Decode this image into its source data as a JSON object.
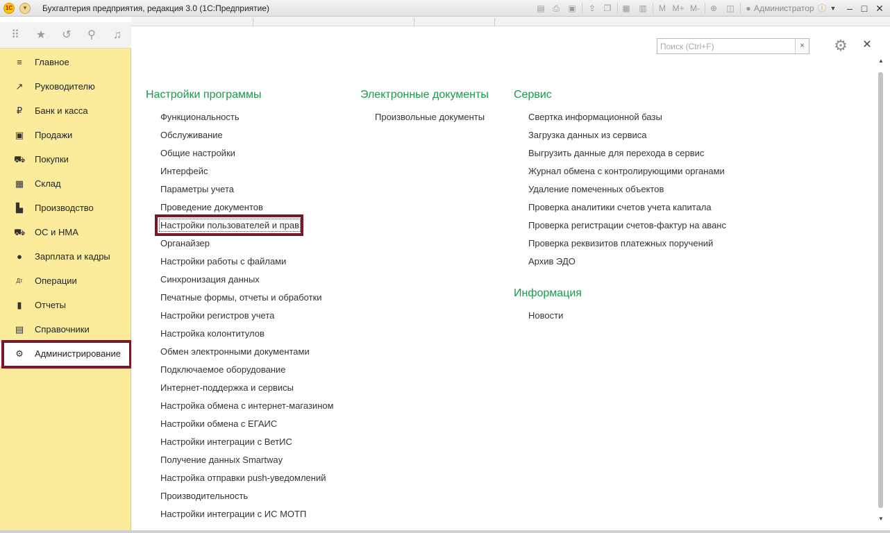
{
  "window": {
    "title": "Бухгалтерия предприятия, редакция 3.0  (1С:Предприятие)",
    "logo": "1С",
    "user": "Администратор",
    "toolbar_icons": [
      "save-icon",
      "print-icon",
      "preview-icon",
      "upload-icon",
      "copy-icon",
      "calculator-icon",
      "calendar-icon"
    ],
    "memory_buttons": [
      "M",
      "M+",
      "M-"
    ]
  },
  "sidebar": {
    "items": [
      {
        "label": "Главное",
        "icon": "menu-lines-icon",
        "glyph": "≡"
      },
      {
        "label": "Руководителю",
        "icon": "trend-icon",
        "glyph": "↗"
      },
      {
        "label": "Банк и касса",
        "icon": "ruble-icon",
        "glyph": "₽"
      },
      {
        "label": "Продажи",
        "icon": "bag-icon",
        "glyph": "▣"
      },
      {
        "label": "Покупки",
        "icon": "cart-icon",
        "glyph": "⛟"
      },
      {
        "label": "Склад",
        "icon": "warehouse-icon",
        "glyph": "▦"
      },
      {
        "label": "Производство",
        "icon": "factory-icon",
        "glyph": "▙"
      },
      {
        "label": "ОС и НМА",
        "icon": "truck-icon",
        "glyph": "⛟"
      },
      {
        "label": "Зарплата и кадры",
        "icon": "person-icon",
        "glyph": "●"
      },
      {
        "label": "Операции",
        "icon": "dt-kt-icon",
        "glyph": "Дт"
      },
      {
        "label": "Отчеты",
        "icon": "bar-chart-icon",
        "glyph": "▮"
      },
      {
        "label": "Справочники",
        "icon": "book-icon",
        "glyph": "▤"
      },
      {
        "label": "Администрирование",
        "icon": "gear-icon",
        "glyph": "⚙"
      }
    ]
  },
  "search": {
    "placeholder": "Поиск (Ctrl+F)",
    "clear": "×"
  },
  "sections": {
    "settings": {
      "title": "Настройки программы",
      "links": [
        "Функциональность",
        "Обслуживание",
        "Общие настройки",
        "Интерфейс",
        "Параметры учета",
        "Проведение документов",
        "Настройки пользователей и прав",
        "Органайзер",
        "Настройки работы с файлами",
        "Синхронизация данных",
        "Печатные формы, отчеты и обработки",
        "Настройки регистров учета",
        "Настройка колонтитулов",
        "Обмен электронными документами",
        "Подключаемое оборудование",
        "Интернет-поддержка и сервисы",
        "Настройка обмена с интернет-магазином",
        "Настройки обмена с ЕГАИС",
        "Настройки интеграции с ВетИС",
        "Получение данных Smartway",
        "Настройка отправки push-уведомлений",
        "Производительность",
        "Настройки интеграции с ИС МОТП"
      ]
    },
    "edocs": {
      "title": "Электронные документы",
      "links": [
        "Произвольные документы"
      ]
    },
    "service": {
      "title": "Сервис",
      "links": [
        "Свертка информационной базы",
        "Загрузка данных из сервиса",
        "Выгрузить данные для перехода в сервис",
        "Журнал обмена с контролирующими органами",
        "Удаление помеченных объектов",
        "Проверка аналитики счетов учета капитала",
        "Проверка регистрации счетов-фактур на аванс",
        "Проверка реквизитов платежных поручений",
        "Архив ЭДО"
      ]
    },
    "info": {
      "title": "Информация",
      "links": [
        "Новости"
      ]
    }
  },
  "colors": {
    "sidebar_bg": "#fbec9c",
    "section_title": "#1a9a4a",
    "highlight_border": "#7a1728"
  }
}
